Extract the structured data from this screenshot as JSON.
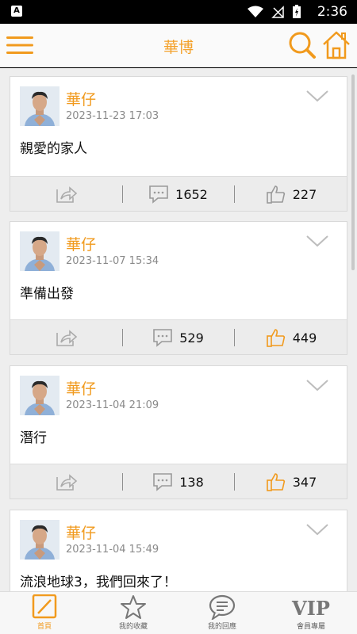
{
  "status_bar": {
    "time": "2:36",
    "app_icon_letter": "A"
  },
  "header": {
    "title": "華博",
    "icons": [
      "menu-icon",
      "search-icon",
      "home-icon"
    ]
  },
  "colors": {
    "accent": "#f19a1d",
    "date": "#8a8a8a",
    "action_bg": "#ececec"
  },
  "posts": [
    {
      "author": "華仔",
      "date": "2023-11-23 17:03",
      "text": "親愛的家人",
      "comments": "1652",
      "likes": "227",
      "liked": false
    },
    {
      "author": "華仔",
      "date": "2023-11-07 15:34",
      "text": "準備出發",
      "comments": "529",
      "likes": "449",
      "liked": true
    },
    {
      "author": "華仔",
      "date": "2023-11-04 21:09",
      "text": "潛行",
      "comments": "138",
      "likes": "347",
      "liked": true
    },
    {
      "author": "華仔",
      "date": "2023-11-04 15:49",
      "text": "流浪地球3，我們回來了！"
    }
  ],
  "bottom_nav": {
    "items": [
      {
        "label": "首頁",
        "icon": "edit-icon",
        "active": true
      },
      {
        "label": "我的收藏",
        "icon": "star-icon",
        "active": false
      },
      {
        "label": "我的回應",
        "icon": "chat-bubble-icon",
        "active": false
      },
      {
        "label": "會員專屬",
        "icon": "vip-icon",
        "active": false
      }
    ],
    "vip_text": "VIP"
  }
}
